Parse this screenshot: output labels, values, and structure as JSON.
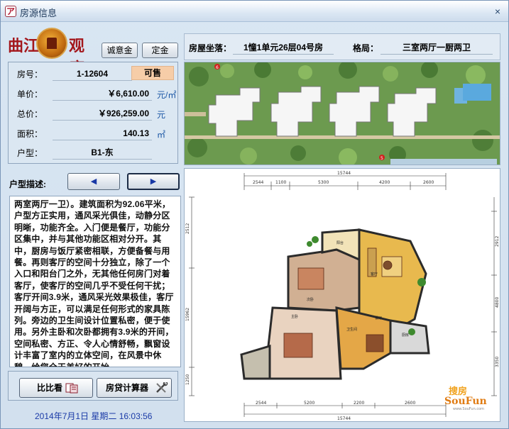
{
  "window": {
    "title": "房源信息",
    "app_icon": "logo-icon",
    "close_glyph": "×"
  },
  "logo": {
    "left_text": "曲江",
    "right_text": "观唐"
  },
  "top_buttons": {
    "deposit_label": "诚意金",
    "reserve_label": "定金"
  },
  "unit_info": {
    "room_no_label": "房号：",
    "room_no": "1-12604",
    "status": "可售",
    "unit_price_label": "单价：",
    "unit_price": "￥6,610.00",
    "unit_price_unit": "元/㎡",
    "total_price_label": "总价：",
    "total_price": "￥926,259.00",
    "total_price_unit": "元",
    "area_label": "面积：",
    "area": "140.13",
    "area_unit": "㎡",
    "type_label": "户型：",
    "type": "B1-东"
  },
  "description": {
    "label": "户型描述:",
    "prev_icon": "arrow-left-icon",
    "next_icon": "arrow-right-icon",
    "text": "两室两厅一卫）。建筑面积为92.06平米，户型方正实用，通风采光俱佳，动静分区明晰，功能齐全。入门便是餐厅，功能分区集中，并与其他功能区相对分开。其中，厨房与饭厅紧密相联，方便备餐与用餐。再则客厅的空间十分独立，除了一个入口和阳台门之外，无其他任何房门对着客厅，使客厅的空间几乎不受任何干扰；客厅开间3.9米，通风采光效果极佳，客厅开阔与方正，可以满足任何形式的家具陈列。旁边的卫生间设计位置私密，便于使用。另外主卧和次卧都拥有3.9米的开间，空间私密、方正、令人心情舒畅，飘窗设计丰富了室内的立体空间，在风景中休憩，给您全天美好的开始。"
  },
  "actions": {
    "compare_label": "比比看",
    "compare_icon": "compare-icon",
    "calc_label": "房贷计算器",
    "calc_icon": "tools-icon"
  },
  "datetime": "2014年7月1日 星期二 16:03:56",
  "location": {
    "label": "房屋坐落：",
    "value": "1憧1单元26层04号房",
    "layout_label": "格局：",
    "layout_value": "三室两厅一厨两卫"
  },
  "siteplan": {
    "marker_1": "6",
    "marker_2": "5"
  },
  "floorplan": {
    "dims_top": [
      "15744",
      "2544",
      "1100",
      "5300",
      "4200",
      "2600"
    ],
    "dims_bottom": [
      "2544",
      "5200",
      "2200",
      "2600",
      "15744"
    ],
    "dims_left": [
      "2512",
      "15962",
      "1250"
    ],
    "dims_right": [
      "2912",
      "4800",
      "3350"
    ],
    "rooms": [
      "次卧",
      "主卧",
      "客厅",
      "餐厅",
      "厨房",
      "卫生间",
      "阳台"
    ],
    "watermark_cn": "搜房",
    "watermark_en": "SouFun",
    "watermark_url": "www.SouFun.com"
  }
}
